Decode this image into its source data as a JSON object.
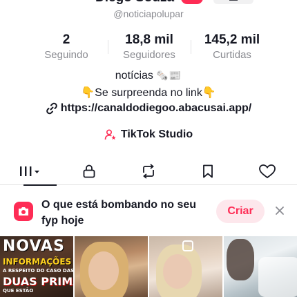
{
  "profile": {
    "display_name": "Diego Souza",
    "handle": "@noticiapolupar"
  },
  "stats": [
    {
      "value": "2",
      "label": "Seguindo"
    },
    {
      "value": "18,8 mil",
      "label": "Seguidores"
    },
    {
      "value": "145,2 mil",
      "label": "Curtidas"
    }
  ],
  "bio": {
    "line1_text": "notícias",
    "line1_emoji": "🗞️📰",
    "line2": "👇Se surpreenda no link👇",
    "link": "https://canaldodiegoo.abacusai.app/"
  },
  "studio": {
    "label": "TikTok Studio"
  },
  "tabs": [
    {
      "name": "videos",
      "icon": "grid-bars-icon"
    },
    {
      "name": "private",
      "icon": "lock-icon"
    },
    {
      "name": "reposts",
      "icon": "repost-icon"
    },
    {
      "name": "favorites",
      "icon": "bookmark-icon"
    },
    {
      "name": "liked",
      "icon": "heart-icon"
    }
  ],
  "banner": {
    "text": "O que está bombando no seu fyp hoje",
    "create_label": "Criar",
    "icon": "camera-icon"
  },
  "thumbnails": {
    "first": {
      "line1": "NOVAS",
      "line2": "INFORMAÇÕES",
      "line3": "A RESPEITO DO CASO DAS",
      "line4": "DUAS PRIMAS",
      "line5": "QUE ESTÃO"
    }
  },
  "colors": {
    "accent": "#fe2c55",
    "text_primary": "#161823",
    "text_secondary": "#8a8b91"
  }
}
